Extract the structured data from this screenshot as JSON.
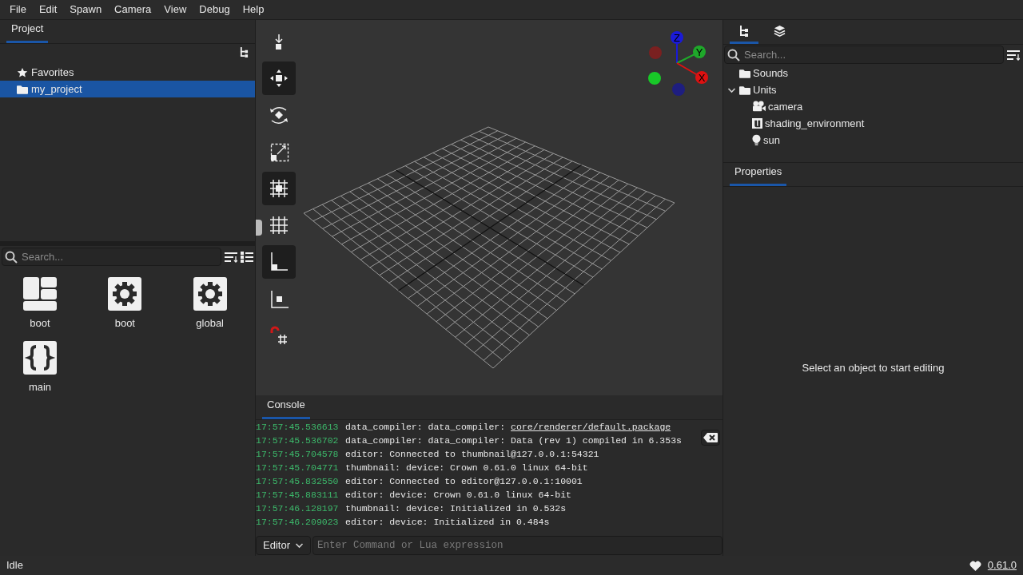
{
  "menu": [
    "File",
    "Edit",
    "Spawn",
    "Camera",
    "View",
    "Debug",
    "Help"
  ],
  "project_panel": {
    "tabs": [
      {
        "label": "Project",
        "selected": true
      }
    ],
    "tree": [
      {
        "label": "Favorites",
        "kind": "star",
        "selected": false
      },
      {
        "label": "my_project",
        "kind": "folder",
        "selected": true
      }
    ]
  },
  "browser": {
    "search": {
      "placeholder": "Search..."
    },
    "items": [
      {
        "label": "boot",
        "kind": "layout"
      },
      {
        "label": "boot",
        "kind": "gear"
      },
      {
        "label": "global",
        "kind": "gear"
      },
      {
        "label": "main",
        "kind": "braces"
      }
    ]
  },
  "toolbar": {
    "tools": [
      {
        "kind": "place",
        "selected": false
      },
      {
        "kind": "move",
        "selected": true
      },
      {
        "kind": "rotate",
        "selected": false
      },
      {
        "kind": "scale",
        "selected": false
      },
      {
        "kind": "snap-point",
        "selected": true
      },
      {
        "kind": "grid",
        "selected": false
      },
      {
        "kind": "local-axes",
        "selected": true
      },
      {
        "kind": "world-axes",
        "selected": false
      },
      {
        "kind": "magnet",
        "selected": false
      }
    ]
  },
  "gizmo": {
    "axes": [
      {
        "label": "Z",
        "color": "#1a1ad8"
      },
      {
        "label": "Y",
        "color": "#1fa82a"
      },
      {
        "label": "X",
        "color": "#dd1111"
      }
    ]
  },
  "console": {
    "tabs": [
      {
        "label": "Console",
        "selected": true
      }
    ],
    "lines": [
      {
        "time": "17:57:45.536613",
        "text": "data_compiler: data_compiler: ",
        "link": "core/renderer/default.package"
      },
      {
        "time": "17:57:45.536702",
        "text": "data_compiler: data_compiler: Data (rev 1) compiled in 6.353s"
      },
      {
        "time": "17:57:45.704578",
        "text": "editor: Connected to thumbnail@127.0.0.1:54321"
      },
      {
        "time": "17:57:45.704771",
        "text": "thumbnail: device: Crown 0.61.0 linux 64-bit"
      },
      {
        "time": "17:57:45.832550",
        "text": "editor: Connected to editor@127.0.0.1:10001"
      },
      {
        "time": "17:57:45.883111",
        "text": "editor: device: Crown 0.61.0 linux 64-bit"
      },
      {
        "time": "17:57:46.128197",
        "text": "thumbnail: device: Initialized in 0.532s"
      },
      {
        "time": "17:57:46.209023",
        "text": "editor: device: Initialized in 0.484s"
      }
    ],
    "input": {
      "target": "Editor",
      "placeholder": "Enter Command or Lua expression"
    }
  },
  "scene_panel": {
    "tabs": [
      {
        "kind": "tree",
        "selected": true
      },
      {
        "kind": "layers",
        "selected": false
      }
    ],
    "search": {
      "placeholder": "Search..."
    },
    "tree": [
      {
        "label": "Sounds",
        "kind": "folder"
      },
      {
        "label": "Units",
        "kind": "folder",
        "expanded": true,
        "children": [
          {
            "label": "camera",
            "kind": "camera"
          },
          {
            "label": "shading_environment",
            "kind": "unit"
          },
          {
            "label": "sun",
            "kind": "light"
          }
        ]
      }
    ]
  },
  "properties_panel": {
    "tabs": [
      {
        "label": "Properties",
        "selected": true
      }
    ],
    "message": "Select an object to start editing"
  },
  "status_bar": {
    "state": "Idle",
    "version": "0.61.0"
  }
}
